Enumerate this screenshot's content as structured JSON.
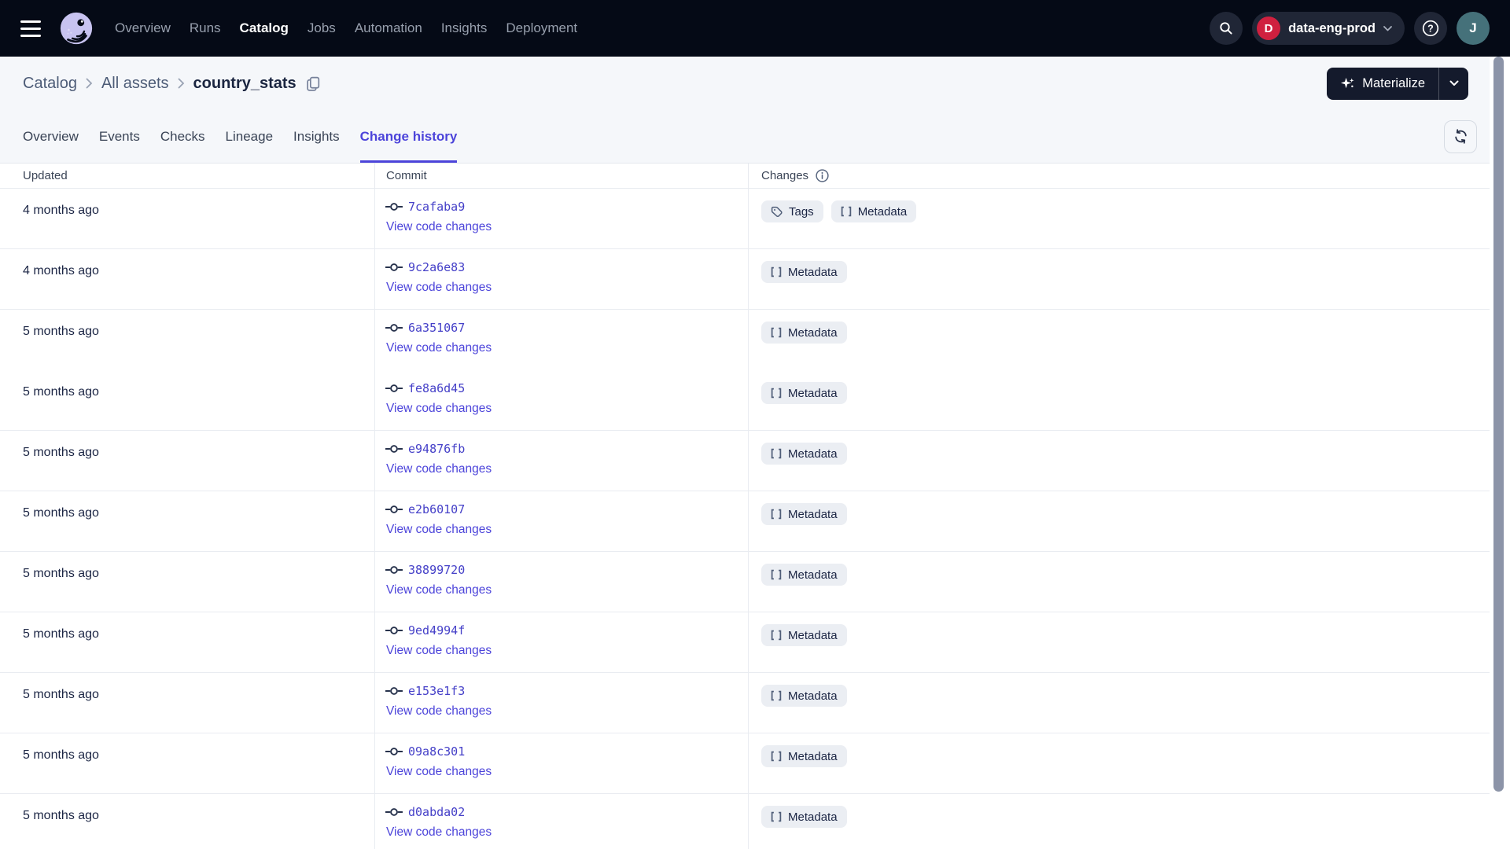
{
  "nav": {
    "items": [
      {
        "label": "Overview",
        "active": false
      },
      {
        "label": "Runs",
        "active": false
      },
      {
        "label": "Catalog",
        "active": true
      },
      {
        "label": "Jobs",
        "active": false
      },
      {
        "label": "Automation",
        "active": false
      },
      {
        "label": "Insights",
        "active": false
      },
      {
        "label": "Deployment",
        "active": false
      }
    ],
    "deployment": {
      "badge": "D",
      "name": "data-eng-prod"
    },
    "user_initial": "J"
  },
  "breadcrumb": {
    "links": [
      "Catalog",
      "All assets"
    ],
    "current": "country_stats"
  },
  "actions": {
    "materialize": "Materialize"
  },
  "tabs": [
    {
      "label": "Overview",
      "active": false
    },
    {
      "label": "Events",
      "active": false
    },
    {
      "label": "Checks",
      "active": false
    },
    {
      "label": "Lineage",
      "active": false
    },
    {
      "label": "Insights",
      "active": false
    },
    {
      "label": "Change history",
      "active": true
    }
  ],
  "table": {
    "columns": [
      "Updated",
      "Commit",
      "Changes"
    ],
    "view_link": "View code changes",
    "rows": [
      {
        "updated": "4 months ago",
        "commit": "7cafaba9",
        "changes": [
          "Tags",
          "Metadata"
        ]
      },
      {
        "updated": "4 months ago",
        "commit": "9c2a6e83",
        "changes": [
          "Metadata"
        ]
      },
      {
        "updated": "5 months ago",
        "commit": "6a351067",
        "changes": [
          "Metadata"
        ],
        "divider_below": false
      },
      {
        "updated": "5 months ago",
        "commit": "fe8a6d45",
        "changes": [
          "Metadata"
        ]
      },
      {
        "updated": "5 months ago",
        "commit": "e94876fb",
        "changes": [
          "Metadata"
        ]
      },
      {
        "updated": "5 months ago",
        "commit": "e2b60107",
        "changes": [
          "Metadata"
        ]
      },
      {
        "updated": "5 months ago",
        "commit": "38899720",
        "changes": [
          "Metadata"
        ]
      },
      {
        "updated": "5 months ago",
        "commit": "9ed4994f",
        "changes": [
          "Metadata"
        ]
      },
      {
        "updated": "5 months ago",
        "commit": "e153e1f3",
        "changes": [
          "Metadata"
        ]
      },
      {
        "updated": "5 months ago",
        "commit": "09a8c301",
        "changes": [
          "Metadata"
        ]
      },
      {
        "updated": "5 months ago",
        "commit": "d0abda02",
        "changes": [
          "Metadata"
        ]
      }
    ]
  },
  "colors": {
    "nav_bg": "#050A16",
    "page_bg": "#F5F7FA",
    "accent": "#4C44DA",
    "hash_link": "#4540C8",
    "badge_bg": "#EBEEF3",
    "deployment_badge_bg": "#D0203F",
    "avatar_bg": "#45717A"
  }
}
